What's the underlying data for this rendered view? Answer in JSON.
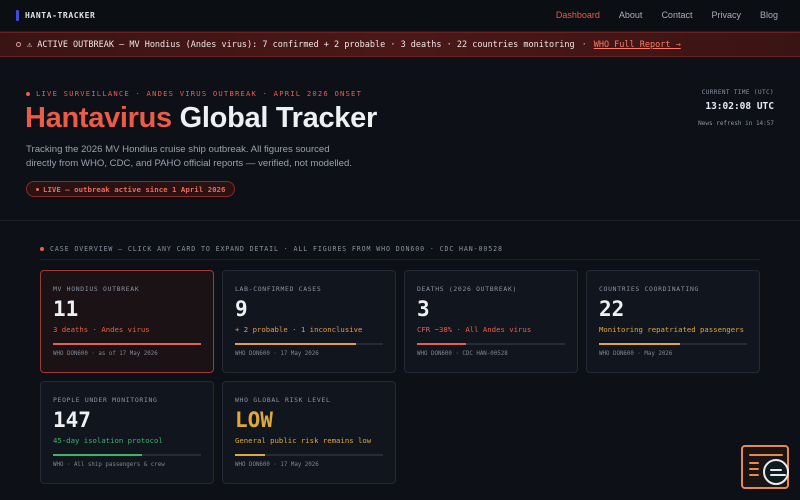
{
  "nav": {
    "brand": "HANTA-TRACKER",
    "links": [
      "Dashboard",
      "About",
      "Contact",
      "Privacy",
      "Blog"
    ],
    "active_index": 0
  },
  "alert": {
    "text": "⚠ ACTIVE OUTBREAK — MV Hondius (Andes virus): 7 confirmed + 2 probable · 3 deaths · 22 countries monitoring",
    "separator": "·",
    "link": "WHO Full Report →"
  },
  "hero": {
    "kicker": "LIVE SURVEILLANCE · ANDES VIRUS OUTBREAK · APRIL 2026 ONSET",
    "title_part1": "Hantavirus",
    "title_part2": "Global Tracker",
    "subtitle": "Tracking the 2026 MV Hondius cruise ship outbreak. All figures sourced directly from WHO, CDC, and PAHO official reports — verified, not modelled.",
    "live_pill": "LIVE — outbreak active since 1 April 2026"
  },
  "clock": {
    "label": "CURRENT TIME (UTC)",
    "time": "13:02:08 UTC",
    "refresh": "News refresh in 14:57"
  },
  "overview": {
    "heading": "CASE OVERVIEW — CLICK ANY CARD TO EXPAND DETAIL · ALL FIGURES FROM WHO DON600 · CDC HAN-00528"
  },
  "cards": [
    {
      "label": "MV HONDIUS OUTBREAK",
      "value": "11",
      "sub": "3 deaths · Andes virus",
      "source": "WHO DON600 · as of 17 May 2026",
      "fill": 1.0,
      "fill_color": "#e8604d",
      "sub_color": "#e8604d",
      "value_color": "#eef0f3",
      "highlight": true
    },
    {
      "label": "LAB-CONFIRMED CASES",
      "value": "9",
      "sub": "+ 2 probable · 1 inconclusive",
      "source": "WHO DON600 · 17 May 2026",
      "fill": 0.82,
      "fill_color": "#e89a4a",
      "sub_color": "#e89a4a",
      "value_color": "#eef0f3",
      "highlight": false
    },
    {
      "label": "DEATHS (2026 OUTBREAK)",
      "value": "3",
      "sub": "CFR ~38% · All Andes virus",
      "source": "WHO DON600 · CDC HAN-00528",
      "fill": 0.33,
      "fill_color": "#e8604d",
      "sub_color": "#e8604d",
      "value_color": "#eef0f3",
      "highlight": false
    },
    {
      "label": "COUNTRIES COORDINATING",
      "value": "22",
      "sub": "Monitoring repatriated passengers",
      "source": "WHO DON600 · May 2026",
      "fill": 0.55,
      "fill_color": "#e0a83c",
      "sub_color": "#e0a83c",
      "value_color": "#eef0f3",
      "highlight": false
    },
    {
      "label": "PEOPLE UNDER MONITORING",
      "value": "147",
      "sub": "45-day isolation protocol",
      "source": "WHO · All ship passengers & crew",
      "fill": 0.6,
      "fill_color": "#3fb56a",
      "sub_color": "#3fb56a",
      "value_color": "#eef0f3",
      "highlight": false
    },
    {
      "label": "WHO GLOBAL RISK LEVEL",
      "value": "LOW",
      "sub": "General public risk remains low",
      "source": "WHO DON600 · 17 May 2026",
      "fill": 0.2,
      "fill_color": "#e0a83c",
      "sub_color": "#e0a83c",
      "value_color": "#e0a83c",
      "highlight": false
    }
  ],
  "widget": {
    "icon": "chat-support-icon"
  }
}
